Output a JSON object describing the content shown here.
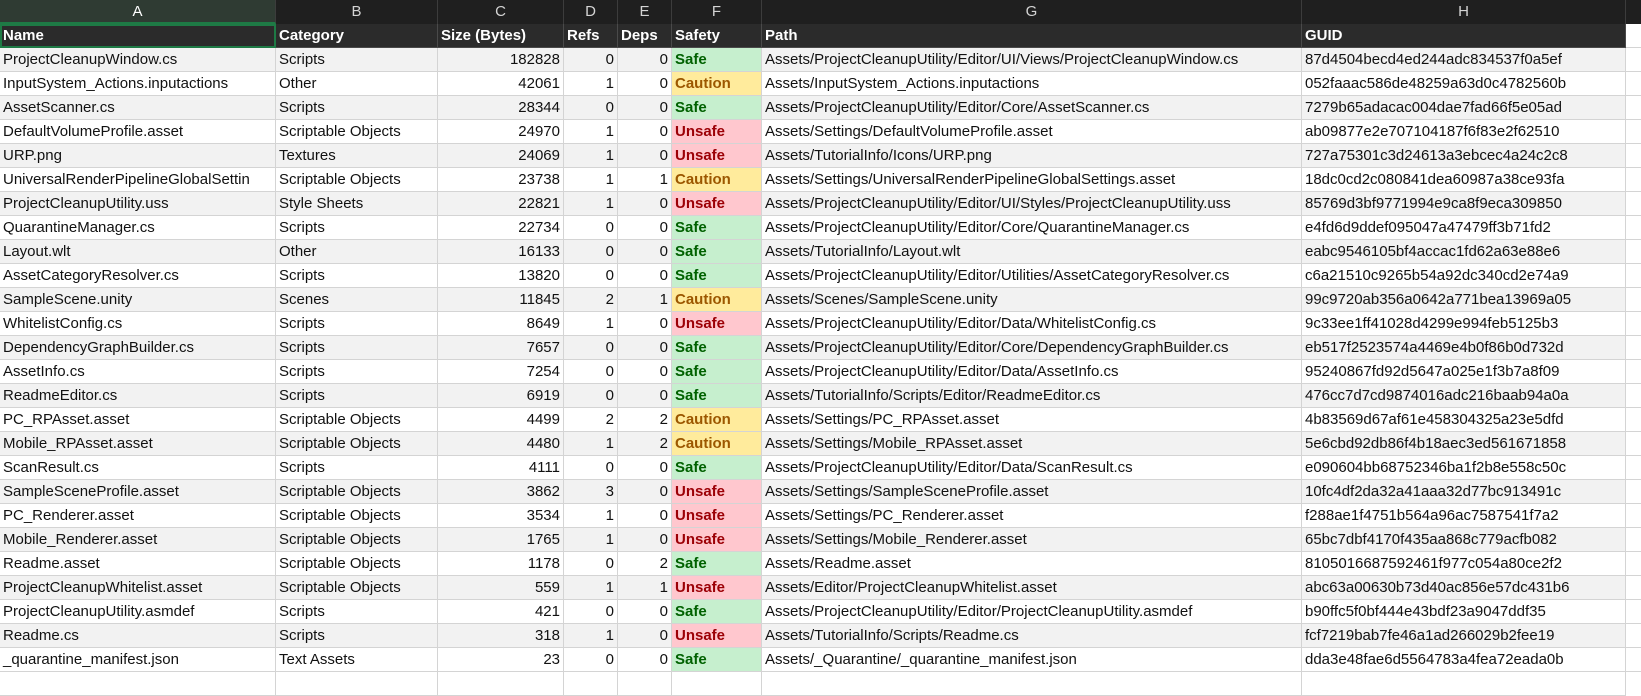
{
  "columns": [
    "A",
    "B",
    "C",
    "D",
    "E",
    "F",
    "G",
    "H"
  ],
  "headers": [
    "Name",
    "Category",
    "Size (Bytes)",
    "Refs",
    "Deps",
    "Safety",
    "Path",
    "GUID"
  ],
  "rows": [
    [
      "ProjectCleanupWindow.cs",
      "Scripts",
      "182828",
      "0",
      "0",
      "Safe",
      "Assets/ProjectCleanupUtility/Editor/UI/Views/ProjectCleanupWindow.cs",
      "87d4504becd4ed244adc834537f0a5ef"
    ],
    [
      "InputSystem_Actions.inputactions",
      "Other",
      "42061",
      "1",
      "0",
      "Caution",
      "Assets/InputSystem_Actions.inputactions",
      "052faaac586de48259a63d0c4782560b"
    ],
    [
      "AssetScanner.cs",
      "Scripts",
      "28344",
      "0",
      "0",
      "Safe",
      "Assets/ProjectCleanupUtility/Editor/Core/AssetScanner.cs",
      "7279b65adacac004dae7fad66f5e05ad"
    ],
    [
      "DefaultVolumeProfile.asset",
      "Scriptable Objects",
      "24970",
      "1",
      "0",
      "Unsafe",
      "Assets/Settings/DefaultVolumeProfile.asset",
      "ab09877e2e707104187f6f83e2f62510"
    ],
    [
      "URP.png",
      "Textures",
      "24069",
      "1",
      "0",
      "Unsafe",
      "Assets/TutorialInfo/Icons/URP.png",
      "727a75301c3d24613a3ebcec4a24c2c8"
    ],
    [
      "UniversalRenderPipelineGlobalSettin",
      "Scriptable Objects",
      "23738",
      "1",
      "1",
      "Caution",
      "Assets/Settings/UniversalRenderPipelineGlobalSettings.asset",
      "18dc0cd2c080841dea60987a38ce93fa"
    ],
    [
      "ProjectCleanupUtility.uss",
      "Style Sheets",
      "22821",
      "1",
      "0",
      "Unsafe",
      "Assets/ProjectCleanupUtility/Editor/UI/Styles/ProjectCleanupUtility.uss",
      "85769d3bf9771994e9ca8f9eca309850"
    ],
    [
      "QuarantineManager.cs",
      "Scripts",
      "22734",
      "0",
      "0",
      "Safe",
      "Assets/ProjectCleanupUtility/Editor/Core/QuarantineManager.cs",
      "e4fd6d9ddef095047a47479ff3b71fd2"
    ],
    [
      "Layout.wlt",
      "Other",
      "16133",
      "0",
      "0",
      "Safe",
      "Assets/TutorialInfo/Layout.wlt",
      "eabc9546105bf4accac1fd62a63e88e6"
    ],
    [
      "AssetCategoryResolver.cs",
      "Scripts",
      "13820",
      "0",
      "0",
      "Safe",
      "Assets/ProjectCleanupUtility/Editor/Utilities/AssetCategoryResolver.cs",
      "c6a21510c9265b54a92dc340cd2e74a9"
    ],
    [
      "SampleScene.unity",
      "Scenes",
      "11845",
      "2",
      "1",
      "Caution",
      "Assets/Scenes/SampleScene.unity",
      "99c9720ab356a0642a771bea13969a05"
    ],
    [
      "WhitelistConfig.cs",
      "Scripts",
      "8649",
      "1",
      "0",
      "Unsafe",
      "Assets/ProjectCleanupUtility/Editor/Data/WhitelistConfig.cs",
      "9c33ee1ff41028d4299e994feb5125b3"
    ],
    [
      "DependencyGraphBuilder.cs",
      "Scripts",
      "7657",
      "0",
      "0",
      "Safe",
      "Assets/ProjectCleanupUtility/Editor/Core/DependencyGraphBuilder.cs",
      "eb517f2523574a4469e4b0f86b0d732d"
    ],
    [
      "AssetInfo.cs",
      "Scripts",
      "7254",
      "0",
      "0",
      "Safe",
      "Assets/ProjectCleanupUtility/Editor/Data/AssetInfo.cs",
      "95240867fd92d5647a025e1f3b7a8f09"
    ],
    [
      "ReadmeEditor.cs",
      "Scripts",
      "6919",
      "0",
      "0",
      "Safe",
      "Assets/TutorialInfo/Scripts/Editor/ReadmeEditor.cs",
      "476cc7d7cd9874016adc216baab94a0a"
    ],
    [
      "PC_RPAsset.asset",
      "Scriptable Objects",
      "4499",
      "2",
      "2",
      "Caution",
      "Assets/Settings/PC_RPAsset.asset",
      "4b83569d67af61e458304325a23e5dfd"
    ],
    [
      "Mobile_RPAsset.asset",
      "Scriptable Objects",
      "4480",
      "1",
      "2",
      "Caution",
      "Assets/Settings/Mobile_RPAsset.asset",
      "5e6cbd92db86f4b18aec3ed561671858"
    ],
    [
      "ScanResult.cs",
      "Scripts",
      "4111",
      "0",
      "0",
      "Safe",
      "Assets/ProjectCleanupUtility/Editor/Data/ScanResult.cs",
      "e090604bb68752346ba1f2b8e558c50c"
    ],
    [
      "SampleSceneProfile.asset",
      "Scriptable Objects",
      "3862",
      "3",
      "0",
      "Unsafe",
      "Assets/Settings/SampleSceneProfile.asset",
      "10fc4df2da32a41aaa32d77bc913491c"
    ],
    [
      "PC_Renderer.asset",
      "Scriptable Objects",
      "3534",
      "1",
      "0",
      "Unsafe",
      "Assets/Settings/PC_Renderer.asset",
      "f288ae1f4751b564a96ac7587541f7a2"
    ],
    [
      "Mobile_Renderer.asset",
      "Scriptable Objects",
      "1765",
      "1",
      "0",
      "Unsafe",
      "Assets/Settings/Mobile_Renderer.asset",
      "65bc7dbf4170f435aa868c779acfb082"
    ],
    [
      "Readme.asset",
      "Scriptable Objects",
      "1178",
      "0",
      "2",
      "Safe",
      "Assets/Readme.asset",
      "8105016687592461f977c054a80ce2f2"
    ],
    [
      "ProjectCleanupWhitelist.asset",
      "Scriptable Objects",
      "559",
      "1",
      "1",
      "Unsafe",
      "Assets/Editor/ProjectCleanupWhitelist.asset",
      "abc63a00630b73d40ac856e57dc431b6"
    ],
    [
      "ProjectCleanupUtility.asmdef",
      "Scripts",
      "421",
      "0",
      "0",
      "Safe",
      "Assets/ProjectCleanupUtility/Editor/ProjectCleanupUtility.asmdef",
      "b90ffc5f0bf444e43bdf23a9047ddf35"
    ],
    [
      "Readme.cs",
      "Scripts",
      "318",
      "1",
      "0",
      "Unsafe",
      "Assets/TutorialInfo/Scripts/Readme.cs",
      "fcf7219bab7fe46a1ad266029b2fee19"
    ],
    [
      "_quarantine_manifest.json",
      "Text Assets",
      "23",
      "0",
      "0",
      "Safe",
      "Assets/_Quarantine/_quarantine_manifest.json",
      "dda3e48fae6d5564783a4fea72eada0b"
    ]
  ],
  "safety_colors": {
    "Safe": {
      "bg": "#c6efce",
      "fg": "#006100"
    },
    "Caution": {
      "bg": "#ffeb9c",
      "fg": "#9c5700"
    },
    "Unsafe": {
      "bg": "#ffc7ce",
      "fg": "#9c0006"
    }
  }
}
